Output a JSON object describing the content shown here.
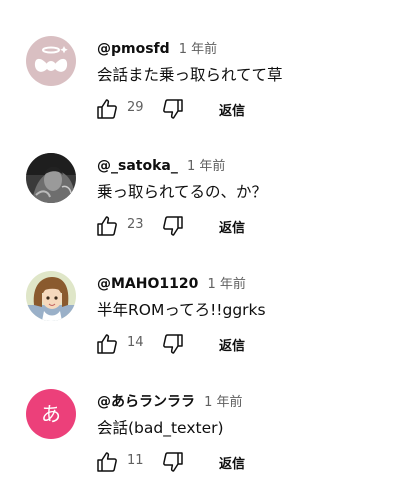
{
  "comments": [
    {
      "author": "@pmosfd",
      "time": "1 年前",
      "text": "会話また乗っ取られてて草",
      "likes": "29",
      "reply_label": "返信",
      "avatar_icon": "angel-wings-icon",
      "avatar_bg": "#d9bfc2"
    },
    {
      "author": "@_satoka_",
      "time": "1 年前",
      "text": "乗っ取られてるの、か？",
      "likes": "23",
      "reply_label": "返信",
      "avatar_icon": "dark-photo-icon"
    },
    {
      "author": "@MAHO1120",
      "time": "1 年前",
      "text": "半年ROMってろ!!ggrks",
      "likes": "14",
      "reply_label": "返信",
      "avatar_icon": "anime-girl-icon"
    },
    {
      "author": "@あらランララ",
      "time": "1 年前",
      "text": "会話(bad_texter)",
      "likes": "11",
      "reply_label": "返信",
      "avatar_letter": "あ",
      "avatar_bg": "#ec407a"
    }
  ]
}
